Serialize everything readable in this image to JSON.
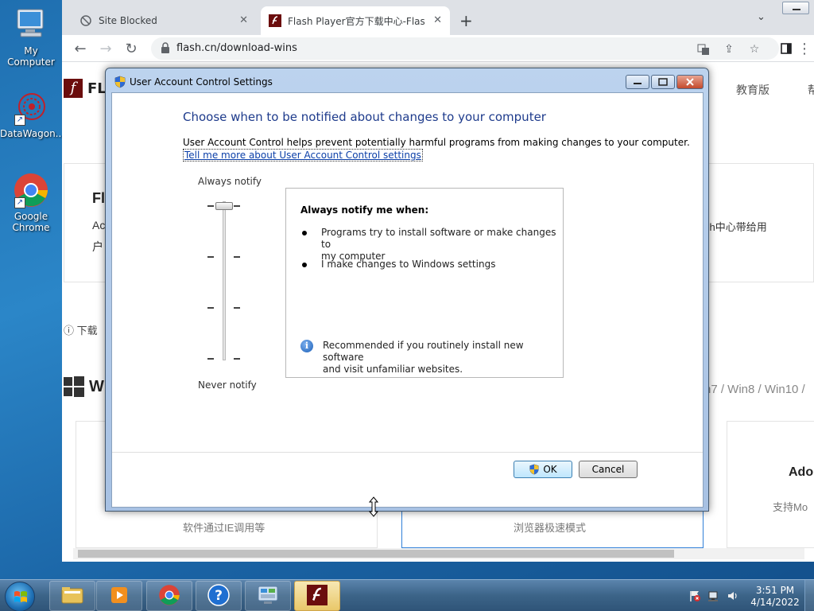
{
  "desktop": {
    "icons": [
      {
        "label": "My Computer"
      },
      {
        "label": "DataWagon..."
      },
      {
        "label": "Google Chrome"
      }
    ]
  },
  "browser": {
    "tabs": [
      {
        "title": "Site Blocked"
      },
      {
        "title": "Flash Player官方下载中心-Flash中"
      }
    ],
    "url": "flash.cn/download-wins",
    "page": {
      "brand_partial": "FL",
      "nav_edu": "教育版",
      "nav_help_partial": "帮",
      "hero_title_partial": "Fl",
      "hero_line1_partial": "Ac",
      "hero_line2_partial": "户",
      "hero_right_partial": "sh中心带给用",
      "notice_partial": "下载",
      "windows_partial": "W",
      "compat_partial": "n7 / Win8 / Win10 /",
      "card1_caption": "软件通过IE调用等",
      "card2_caption": "浏览器极速模式",
      "card3_title_partial": "Ado",
      "card3_sub_partial": "支持Mo"
    }
  },
  "uac": {
    "title": "User Account Control Settings",
    "heading": "Choose when to be notified about changes to your computer",
    "description": "User Account Control helps prevent potentially harmful programs from making changes to your computer.",
    "link": "Tell me more about User Account Control settings",
    "slider": {
      "top_label": "Always notify",
      "bottom_label": "Never notify",
      "level": 4,
      "levels": 4
    },
    "info": {
      "title": "Always notify me when:",
      "bullets": [
        {
          "line1": "Programs try to install software or make changes to",
          "line2": "my computer"
        },
        {
          "line1": "I make changes to Windows settings",
          "line2": ""
        }
      ],
      "recommend_line1": "Recommended if you routinely install new software",
      "recommend_line2": "and visit unfamiliar websites."
    },
    "ok_label": "OK",
    "cancel_label": "Cancel"
  },
  "taskbar": {
    "time": "3:51 PM",
    "date": "4/14/2022"
  },
  "colors": {
    "uac_heading": "#1e3b8c",
    "link": "#0b3fa8",
    "flash_red": "#6b0d0d"
  }
}
